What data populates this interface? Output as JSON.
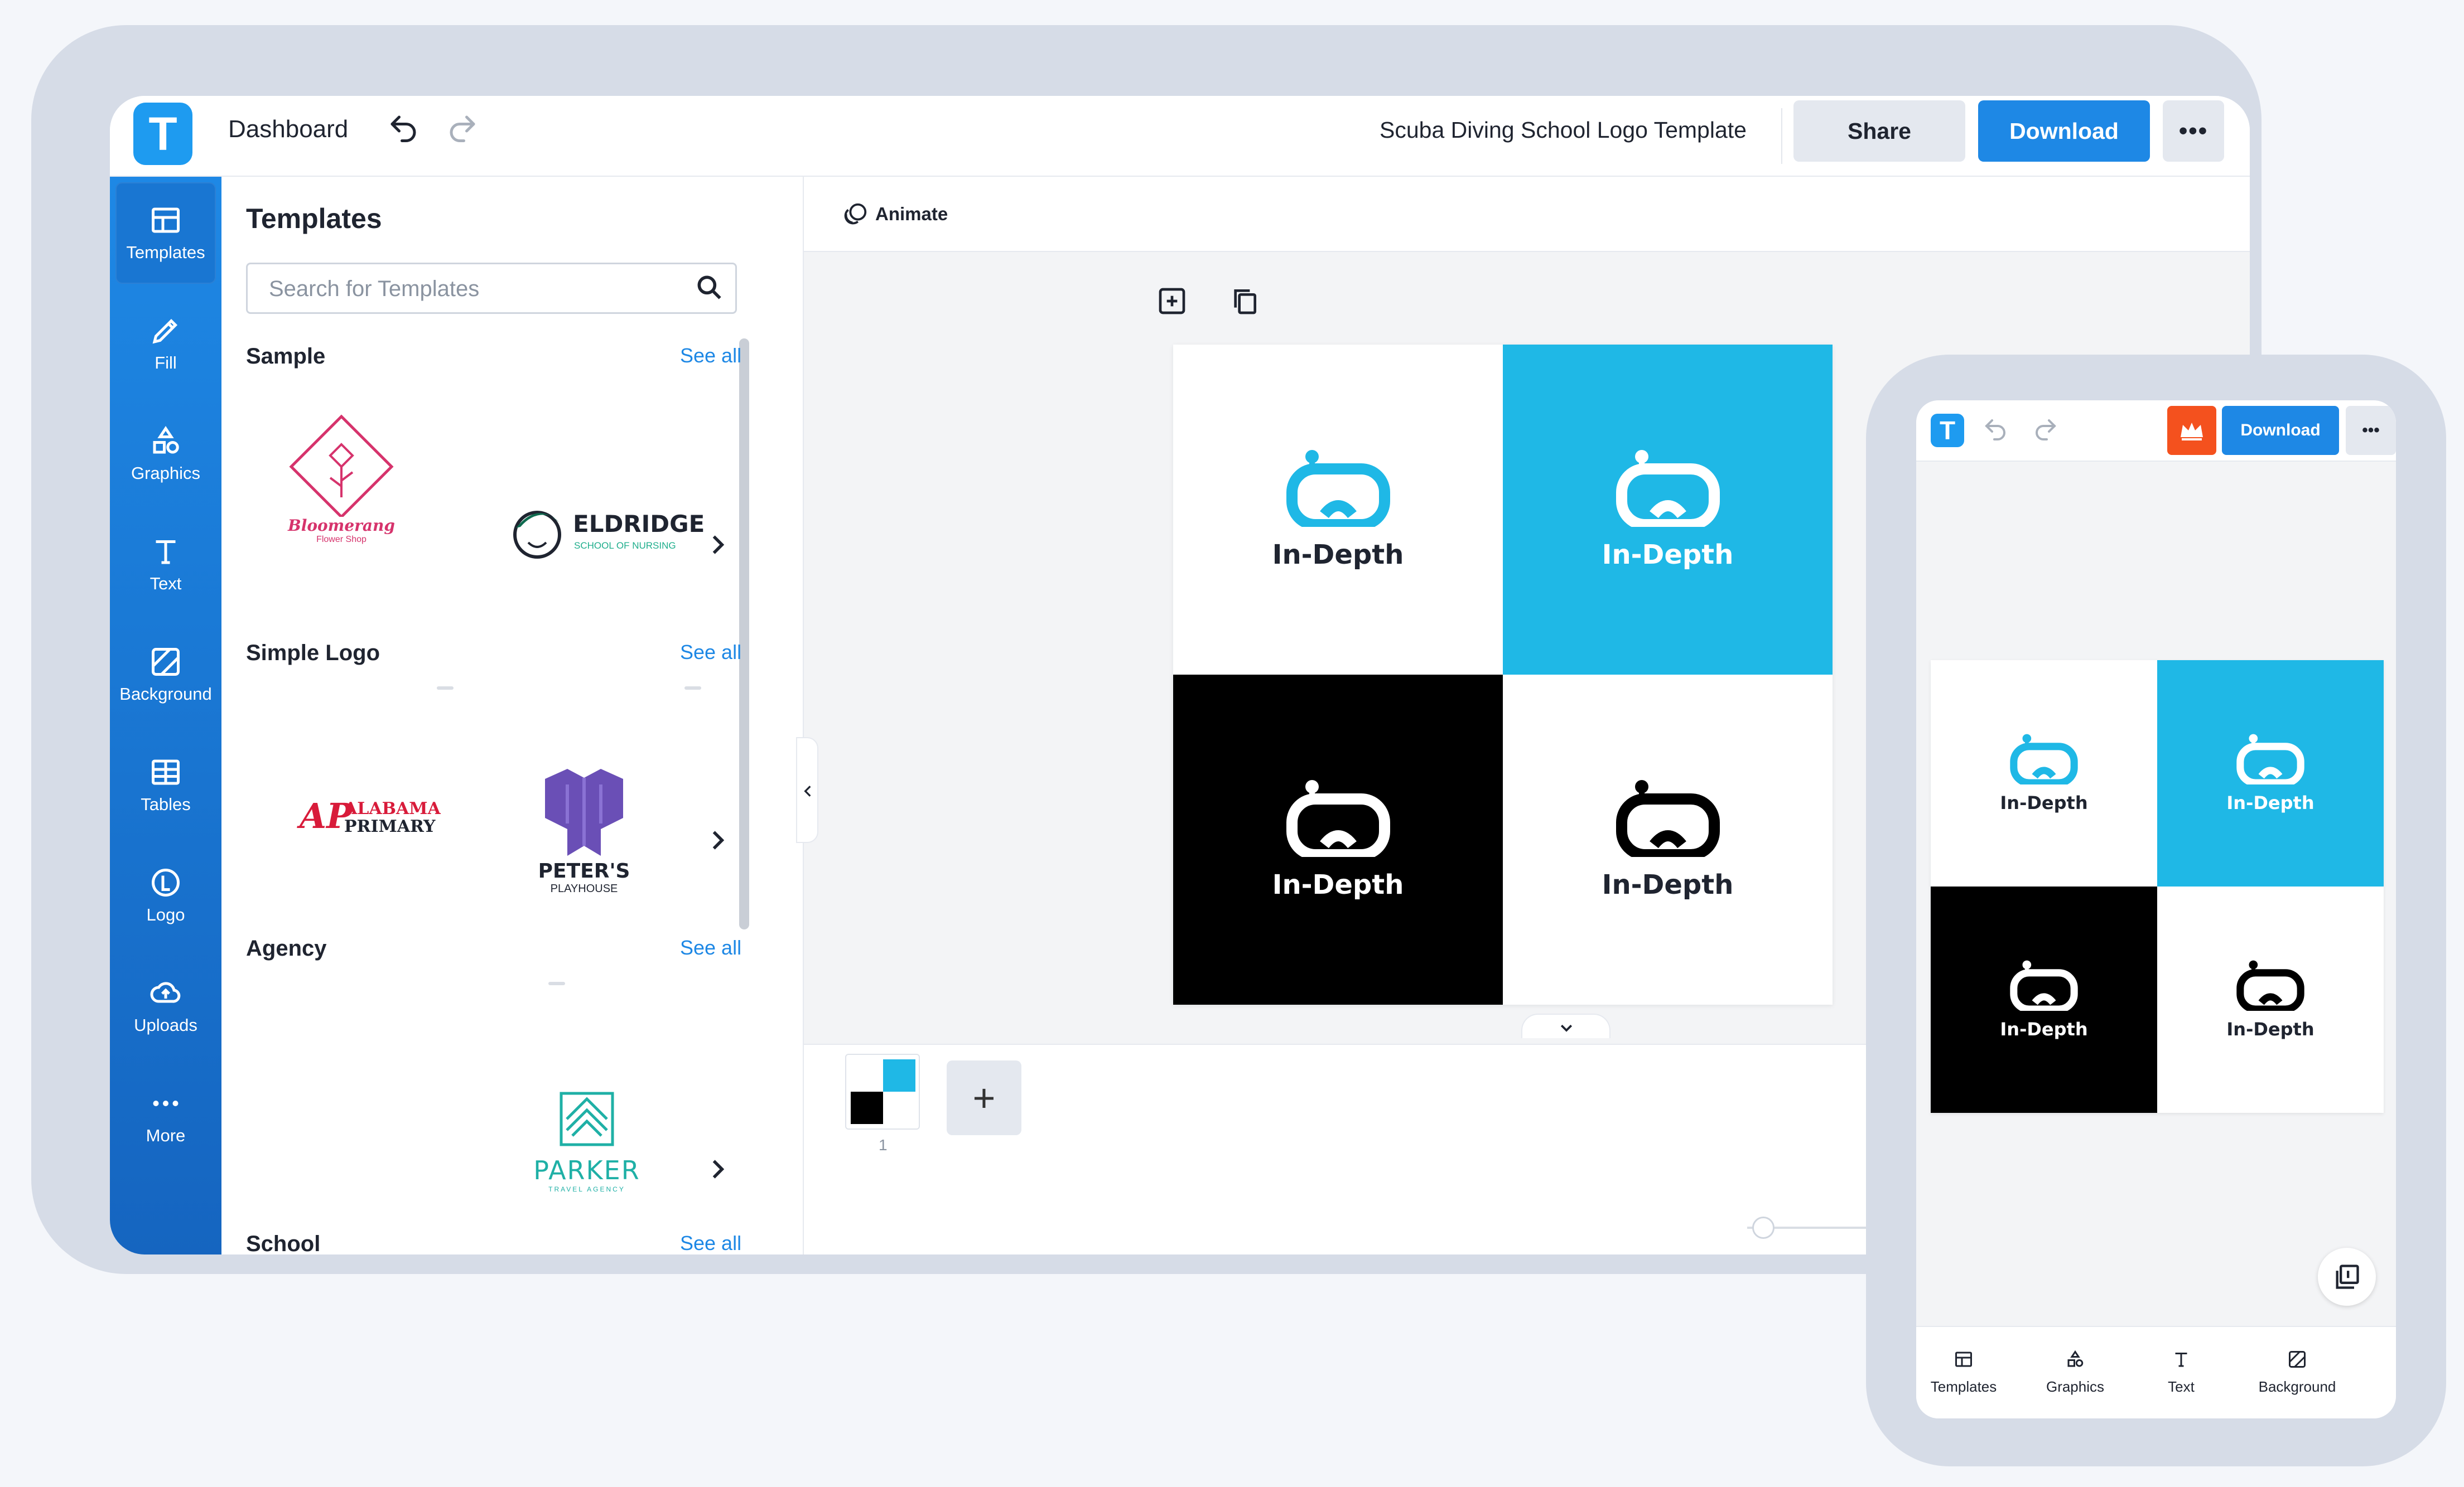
{
  "app": {
    "logo_letter": "T"
  },
  "topbar": {
    "dashboard_label": "Dashboard",
    "document_title": "Scuba Diving School Logo Template",
    "share_label": "Share",
    "download_label": "Download",
    "more_label": "•••"
  },
  "rail": {
    "items": [
      {
        "label": "Templates",
        "icon": "templates-icon"
      },
      {
        "label": "Fill",
        "icon": "pencil-icon"
      },
      {
        "label": "Graphics",
        "icon": "shapes-icon"
      },
      {
        "label": "Text",
        "icon": "text-icon"
      },
      {
        "label": "Background",
        "icon": "background-icon"
      },
      {
        "label": "Tables",
        "icon": "table-icon"
      },
      {
        "label": "Logo",
        "icon": "logo-icon"
      },
      {
        "label": "Uploads",
        "icon": "cloud-upload-icon"
      },
      {
        "label": "More",
        "icon": "more-dots-icon"
      }
    ]
  },
  "panel": {
    "title": "Templates",
    "search_placeholder": "Search for Templates",
    "see_all": "See all",
    "sections": [
      {
        "title": "Sample",
        "templates": [
          {
            "name": "Bloomerang",
            "tagline": "Flower Shop"
          },
          {
            "name": "ELDRIDGE",
            "tagline": "SCHOOL OF NURSING"
          }
        ]
      },
      {
        "title": "Simple Logo",
        "templates": [
          {
            "name": "ALABAMA",
            "tagline": "PRIMARY"
          },
          {
            "name": "PETER'S",
            "tagline": "PLAYHOUSE"
          }
        ]
      },
      {
        "title": "Agency",
        "templates": [
          {
            "name": "PARKER",
            "tagline": "TRAVEL AGENCY"
          }
        ]
      },
      {
        "title": "School",
        "templates": []
      }
    ]
  },
  "editor": {
    "animate_label": "Animate",
    "brand_name": "In-Depth",
    "page_number": "1",
    "add_page_label": "+",
    "colors": {
      "accent": "#1fb8e6",
      "black": "#000000",
      "white": "#ffffff",
      "brand_blue": "#1e88e5"
    }
  },
  "mobile": {
    "download_label": "Download",
    "more_label": "•••",
    "bottom_nav": [
      {
        "label": "Templates",
        "icon": "templates-icon"
      },
      {
        "label": "Graphics",
        "icon": "shapes-icon"
      },
      {
        "label": "Text",
        "icon": "text-icon"
      },
      {
        "label": "Background",
        "icon": "background-icon"
      }
    ]
  }
}
